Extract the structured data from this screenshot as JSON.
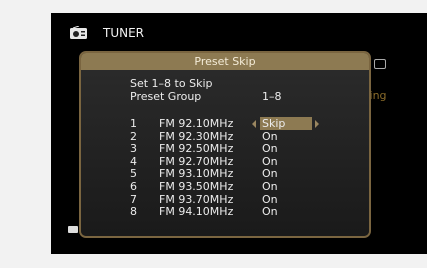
{
  "header": {
    "source_title": "TUNER"
  },
  "background": {
    "status_partial": "ying"
  },
  "dialog": {
    "title": "Preset Skip",
    "set_label": "Set 1–8 to Skip",
    "group_label": "Preset Group",
    "group_value": "1–8",
    "selected_index": 0,
    "presets": [
      {
        "number": "1",
        "frequency": "FM 92.10MHz",
        "status": "Skip"
      },
      {
        "number": "2",
        "frequency": "FM 92.30MHz",
        "status": "On"
      },
      {
        "number": "3",
        "frequency": "FM 92.50MHz",
        "status": "On"
      },
      {
        "number": "4",
        "frequency": "FM 92.70MHz",
        "status": "On"
      },
      {
        "number": "5",
        "frequency": "FM 93.10MHz",
        "status": "On"
      },
      {
        "number": "6",
        "frequency": "FM 93.50MHz",
        "status": "On"
      },
      {
        "number": "7",
        "frequency": "FM 93.70MHz",
        "status": "On"
      },
      {
        "number": "8",
        "frequency": "FM 94.10MHz",
        "status": "On"
      }
    ]
  },
  "colors": {
    "screen_bg": "#000000",
    "accent": "#8d7a52",
    "text": "#ececec"
  },
  "icons": {
    "tuner": "tuner-radio-icon",
    "left": "arrow-left-icon",
    "right": "arrow-right-icon"
  }
}
